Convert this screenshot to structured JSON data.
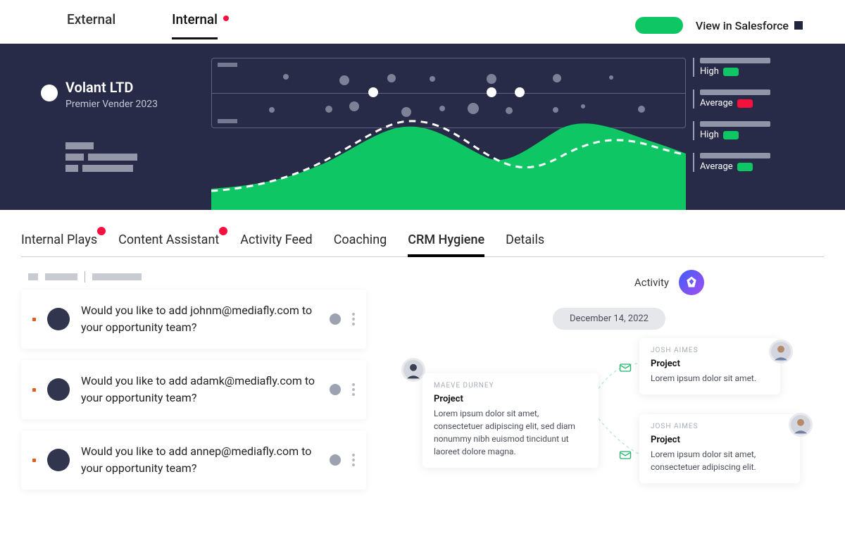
{
  "top": {
    "tabs": [
      {
        "label": "External",
        "active": false,
        "indicator": false
      },
      {
        "label": "Internal",
        "active": true,
        "indicator": true
      }
    ],
    "salesforce_label": "View in Salesforce"
  },
  "hero": {
    "company": "Volant LTD",
    "subtitle": "Premier Vender 2023",
    "meters": [
      {
        "label": "High",
        "color": "green"
      },
      {
        "label": "Average",
        "color": "red"
      },
      {
        "label": "High",
        "color": "green"
      },
      {
        "label": "Average",
        "color": "green"
      }
    ]
  },
  "nav": {
    "tabs": [
      {
        "label": "Internal Plays",
        "active": false,
        "indicator": true
      },
      {
        "label": "Content Assistant",
        "active": false,
        "indicator": true
      },
      {
        "label": "Activity Feed",
        "active": false,
        "indicator": false
      },
      {
        "label": "Coaching",
        "active": false,
        "indicator": false
      },
      {
        "label": "CRM Hygiene",
        "active": true,
        "indicator": false
      },
      {
        "label": "Details",
        "active": false,
        "indicator": false
      }
    ]
  },
  "cards": [
    {
      "text": "Would you like to add johnm@mediafly.com to your opportunity team?"
    },
    {
      "text": "Would you like to add adamk@mediafly.com to your opportunity team?"
    },
    {
      "text": "Would you like to add annep@mediafly.com to your opportunity team?"
    }
  ],
  "activity": {
    "title": "Activity",
    "date": "December 14, 2022",
    "messages": [
      {
        "who": "MAEVE DURNEY",
        "title": "Project",
        "body": "Lorem ipsum dolor sit amet, consectetuer adipiscing elit, sed diam nonummy nibh euismod tincidunt ut laoreet dolore magna."
      },
      {
        "who": "JOSH AIMES",
        "title": "Project",
        "body": "Lorem ipsum dolor sit amet."
      },
      {
        "who": "JOSH AIMES",
        "title": "Project",
        "body": "Lorem ipsum dolor sit amet, consectetuer adipiscing elit."
      }
    ]
  },
  "colors": {
    "accent": "#0ec764",
    "alert": "#f5103e",
    "navy": "#272b47"
  },
  "chart_data": {
    "type": "area",
    "x": [
      0,
      0.1,
      0.2,
      0.3,
      0.37,
      0.45,
      0.55,
      0.65,
      0.72,
      0.8,
      0.9,
      1.0
    ],
    "series": [
      {
        "name": "filled",
        "values": [
          0.25,
          0.28,
          0.35,
          0.55,
          0.92,
          0.78,
          0.6,
          0.85,
          1.0,
          0.95,
          0.82,
          0.68
        ]
      },
      {
        "name": "dashed",
        "values": [
          0.22,
          0.25,
          0.4,
          0.62,
          0.98,
          0.85,
          0.7,
          0.6,
          0.78,
          0.9,
          0.8,
          0.65
        ]
      }
    ],
    "ylim": [
      0,
      1
    ]
  }
}
